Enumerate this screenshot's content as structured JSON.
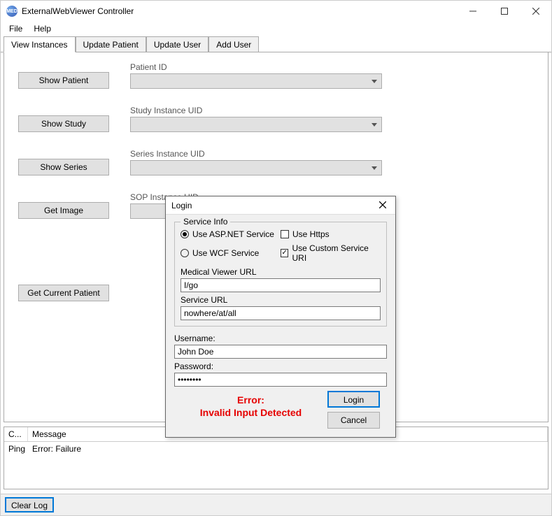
{
  "titlebar": {
    "app_icon_text": "MED",
    "title": "ExternalWebViewer Controller"
  },
  "menubar": {
    "file": "File",
    "help": "Help"
  },
  "tabs": [
    {
      "label": "View Instances",
      "active": true
    },
    {
      "label": "Update Patient",
      "active": false
    },
    {
      "label": "Update User",
      "active": false
    },
    {
      "label": "Add User",
      "active": false
    }
  ],
  "view_instances": {
    "patient_id_label": "Patient ID",
    "show_patient_btn": "Show Patient",
    "study_uid_label": "Study Instance UID",
    "show_study_btn": "Show Study",
    "series_uid_label": "Series Instance UID",
    "show_series_btn": "Show Series",
    "sop_uid_label": "SOP Instance UID",
    "get_image_btn": "Get Image",
    "get_current_patient_btn": "Get Current Patient",
    "patient_id_value": "",
    "study_uid_value": "",
    "series_uid_value": "",
    "sop_uid_value": ""
  },
  "dialog": {
    "title": "Login",
    "group_legend": "Service Info",
    "opt_asp": "Use ASP.NET Service",
    "opt_wcf": "Use WCF Service",
    "opt_https": "Use Https",
    "opt_custom_uri": "Use Custom Service URI",
    "asp_selected": true,
    "wcf_selected": false,
    "https_checked": false,
    "custom_uri_checked": true,
    "medical_url_label": "Medical Viewer URL",
    "medical_url_value": "I/go",
    "service_url_label": "Service URL",
    "service_url_value": "nowhere/at/all",
    "username_label": "Username:",
    "username_value": "John Doe",
    "password_label": "Password:",
    "password_value": "••••••••",
    "login_btn": "Login",
    "cancel_btn": "Cancel",
    "error_line1": "Error:",
    "error_line2": "Invalid Input Detected"
  },
  "log": {
    "col0": "C...",
    "col1": "Message",
    "rows": [
      {
        "c0": "Ping",
        "c1": "Error: Failure"
      }
    ]
  },
  "footer": {
    "clear_log_btn": "Clear Log"
  }
}
